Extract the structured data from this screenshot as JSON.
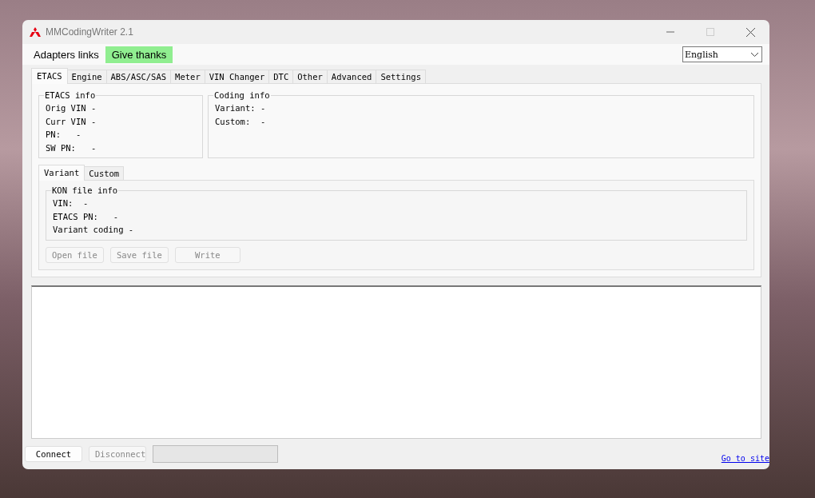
{
  "window": {
    "title": "MMCodingWriter 2.1"
  },
  "menu": [
    {
      "label": "Adapters links",
      "highlighted": false
    },
    {
      "label": "Give thanks",
      "highlighted": true
    }
  ],
  "language": {
    "value": "English"
  },
  "tabs": [
    {
      "label": "ETACS",
      "selected": true
    },
    {
      "label": "Engine",
      "selected": false
    },
    {
      "label": "ABS/ASC/SAS",
      "selected": false
    },
    {
      "label": "Meter",
      "selected": false
    },
    {
      "label": "VIN Changer",
      "selected": false
    },
    {
      "label": "DTC",
      "selected": false
    },
    {
      "label": "Other",
      "selected": false
    },
    {
      "label": "Advanced",
      "selected": false
    },
    {
      "label": "Settings",
      "selected": false
    }
  ],
  "etacs_info": {
    "title": "ETACS info",
    "lines": [
      "Orig VIN -",
      "Curr VIN -",
      "PN:   -",
      "SW PN:   -"
    ]
  },
  "coding_info": {
    "title": "Coding info",
    "lines": [
      "Variant: -",
      "Custom:  -"
    ]
  },
  "sub_tabs": [
    {
      "label": "Variant",
      "selected": true
    },
    {
      "label": "Custom",
      "selected": false
    }
  ],
  "kon_file_info": {
    "title": "KON file info",
    "lines": [
      "VIN:  -",
      "ETACS PN:   -",
      "Variant coding -"
    ]
  },
  "file_buttons": [
    {
      "label": "Open file",
      "disabled": true
    },
    {
      "label": "Save file",
      "disabled": true
    },
    {
      "label": "Write",
      "disabled": true
    }
  ],
  "bottom_buttons": [
    {
      "label": "Connect",
      "disabled": false
    },
    {
      "label": "Disconnect",
      "disabled": true
    }
  ],
  "progress": {
    "level": 0
  },
  "link": "Go to site"
}
